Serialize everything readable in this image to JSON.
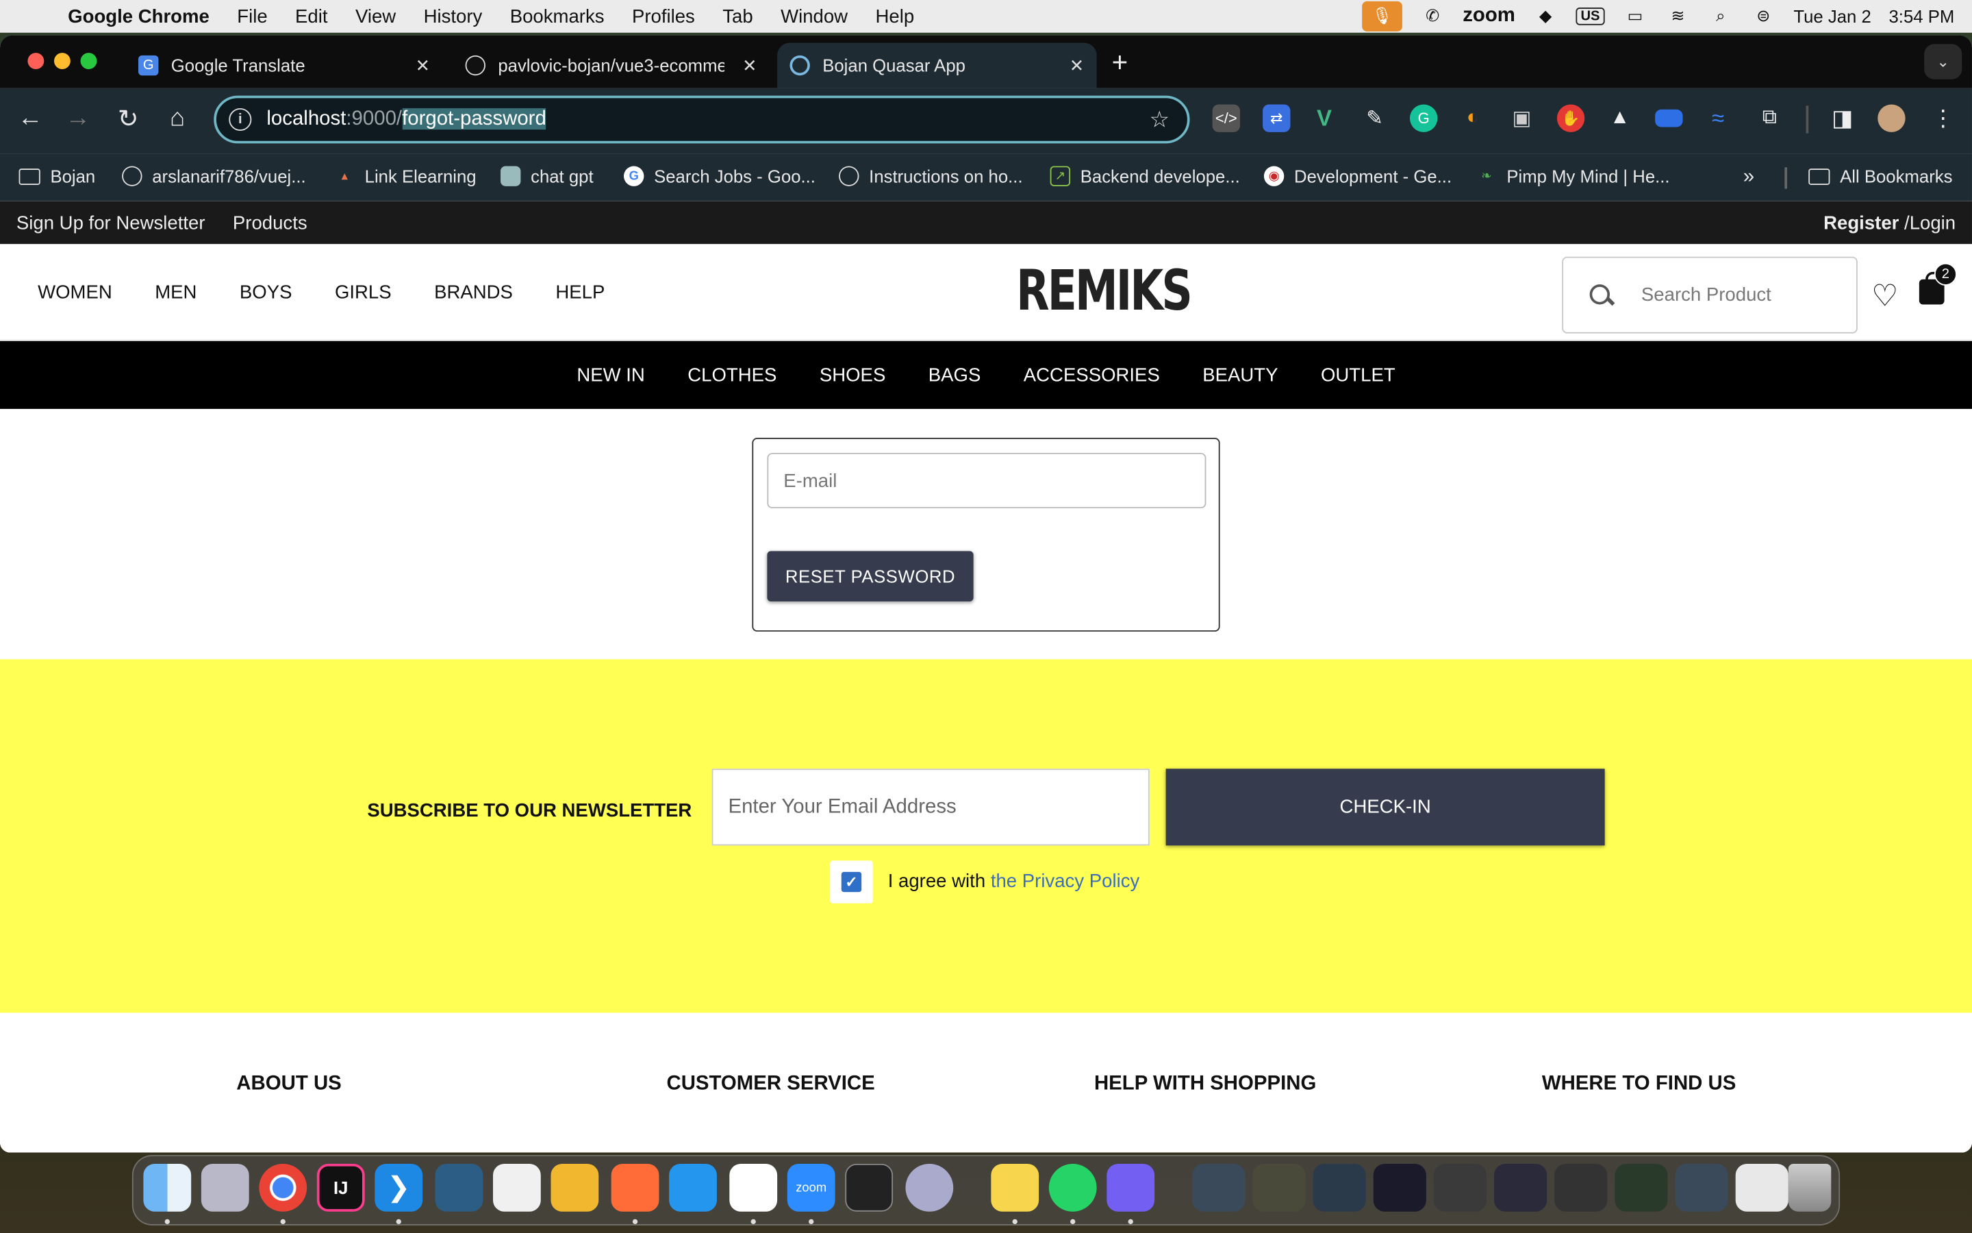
{
  "menubar": {
    "app": "Google Chrome",
    "items": [
      "File",
      "Edit",
      "View",
      "History",
      "Bookmarks",
      "Profiles",
      "Tab",
      "Window",
      "Help"
    ],
    "zoom": "zoom",
    "keyboard": "US",
    "date": "Tue Jan 2",
    "time": "3:54 PM"
  },
  "tabs": [
    {
      "title": "Google Translate",
      "icon": "google-translate-icon"
    },
    {
      "title": "pavlovic-bojan/vue3-ecomme",
      "icon": "github-icon"
    },
    {
      "title": "Bojan Quasar App",
      "icon": "quasar-icon"
    }
  ],
  "omnibox": {
    "host": "localhost",
    "port": ":9000/",
    "path": "forgot-password"
  },
  "bookmarks": [
    {
      "label": "Bojan",
      "icon": "folder-icon"
    },
    {
      "label": "arslanarif786/vuej...",
      "icon": "github-icon"
    },
    {
      "label": "Link Elearning",
      "icon": "graduation-cap-icon"
    },
    {
      "label": "chat gpt",
      "icon": "chatgpt-icon"
    },
    {
      "label": "Search Jobs - Goo...",
      "icon": "google-icon"
    },
    {
      "label": "Instructions on ho...",
      "icon": "github-icon"
    },
    {
      "label": "Backend develope...",
      "icon": "upwork-icon"
    },
    {
      "label": "Development - Ge...",
      "icon": "dev-icon"
    },
    {
      "label": "Pimp My Mind | He...",
      "icon": "leaf-icon"
    }
  ],
  "all_bookmarks": "All Bookmarks",
  "site": {
    "top_links": {
      "newsletter": "Sign Up for Newsletter",
      "products": "Products",
      "register": "Register",
      "login": "/Login"
    },
    "main_nav": [
      "WOMEN",
      "MEN",
      "BOYS",
      "GIRLS",
      "BRANDS",
      "HELP"
    ],
    "logo": "REMIKS",
    "search_placeholder": "Search Product",
    "cart_count": "2",
    "categories": [
      "NEW IN",
      "CLOTHES",
      "SHOES",
      "BAGS",
      "ACCESSORIES",
      "BEAUTY",
      "OUTLET"
    ],
    "reset": {
      "email_placeholder": "E-mail",
      "button": "RESET PASSWORD"
    },
    "newsletter": {
      "title": "SUBSCRIBE TO OUR NEWSLETTER",
      "email_placeholder": "Enter Your Email Address",
      "button": "CHECK-IN",
      "agree_text": "I agree with",
      "agree_link": "the Privacy Policy",
      "checked": true
    },
    "footer_columns": [
      "ABOUT US",
      "CUSTOMER SERVICE",
      "HELP WITH SHOPPING",
      "WHERE TO FIND US"
    ]
  },
  "colors": {
    "newsletter_bg": "#ffff54",
    "button_bg": "#363c4d",
    "link": "#3c6fb8"
  }
}
